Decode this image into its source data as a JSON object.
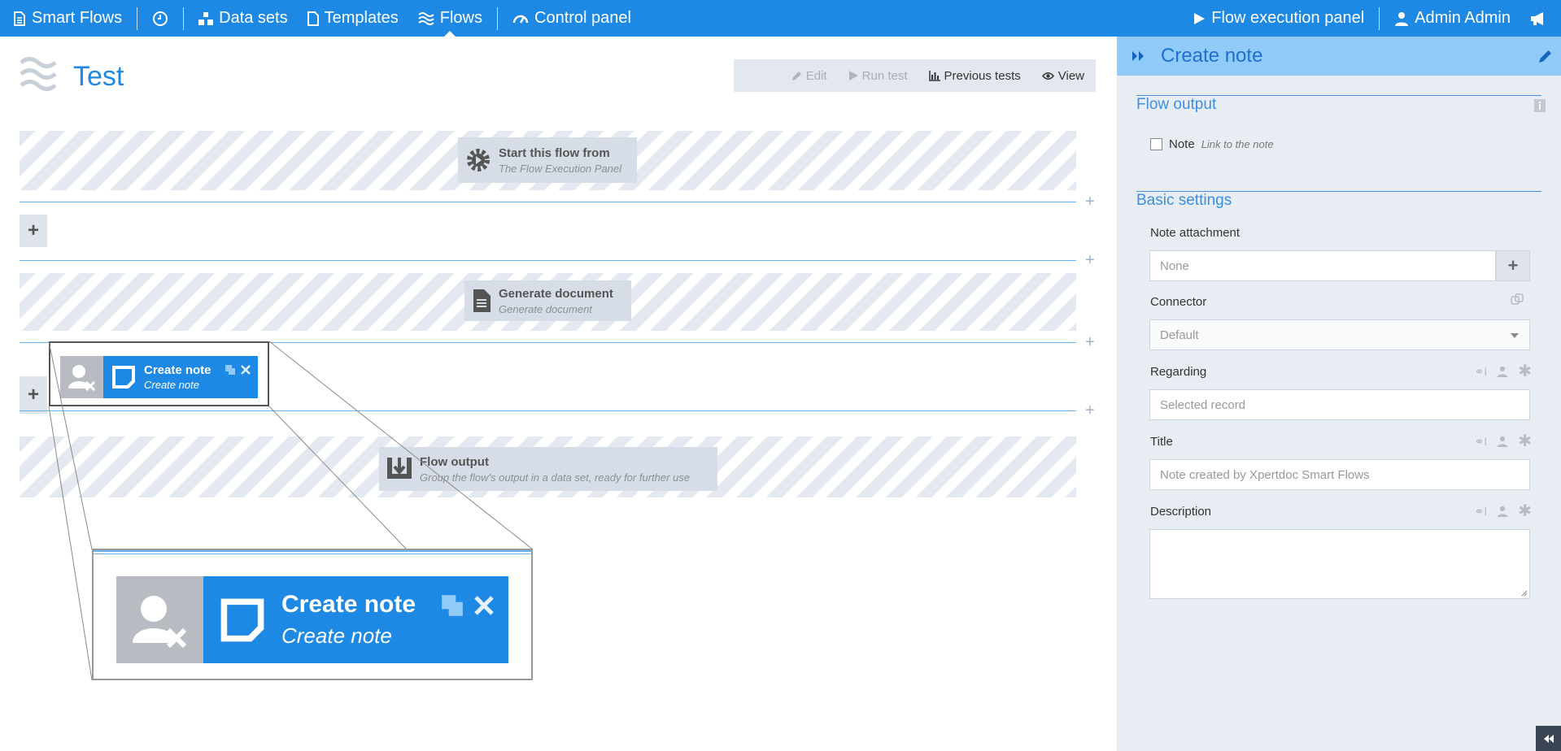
{
  "nav": {
    "brand": "Smart Flows",
    "data_sets": "Data sets",
    "templates": "Templates",
    "flows": "Flows",
    "control_panel": "Control panel",
    "flow_execution_panel": "Flow execution panel",
    "user": "Admin Admin"
  },
  "page": {
    "title": "Test"
  },
  "toolbar": {
    "edit": "Edit",
    "run_test": "Run test",
    "previous_tests": "Previous tests",
    "view": "View"
  },
  "flow": {
    "start": {
      "title": "Start this flow from",
      "subtitle": "The Flow Execution Panel"
    },
    "generate": {
      "title": "Generate document",
      "subtitle": "Generate document"
    },
    "create_note": {
      "title": "Create note",
      "subtitle": "Create note"
    },
    "output": {
      "title": "Flow output",
      "subtitle": "Group the flow's output in a data set, ready for further use"
    },
    "add_symbol": "+"
  },
  "panel": {
    "title": "Create note",
    "flow_output_section": "Flow output",
    "note_label": "Note",
    "note_hint": "Link to the note",
    "basic_section": "Basic settings",
    "note_attachment_label": "Note attachment",
    "note_attachment_value": "None",
    "connector_label": "Connector",
    "connector_value": "Default",
    "regarding_label": "Regarding",
    "regarding_placeholder": "Selected record",
    "title_label": "Title",
    "title_placeholder": "Note created by Xpertdoc Smart Flows",
    "description_label": "Description"
  }
}
